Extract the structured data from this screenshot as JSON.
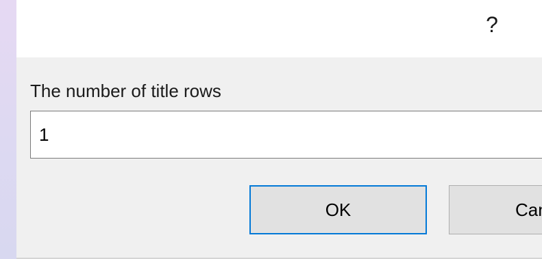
{
  "titlebar": {
    "help_label": "?"
  },
  "prompt": {
    "label": "The number of title rows",
    "value": "1"
  },
  "buttons": {
    "ok_label": "OK",
    "cancel_label": "Can"
  },
  "colors": {
    "accent": "#0078d7",
    "dialog_background": "#f0f0f0",
    "titlebar_background": "#ffffff"
  }
}
